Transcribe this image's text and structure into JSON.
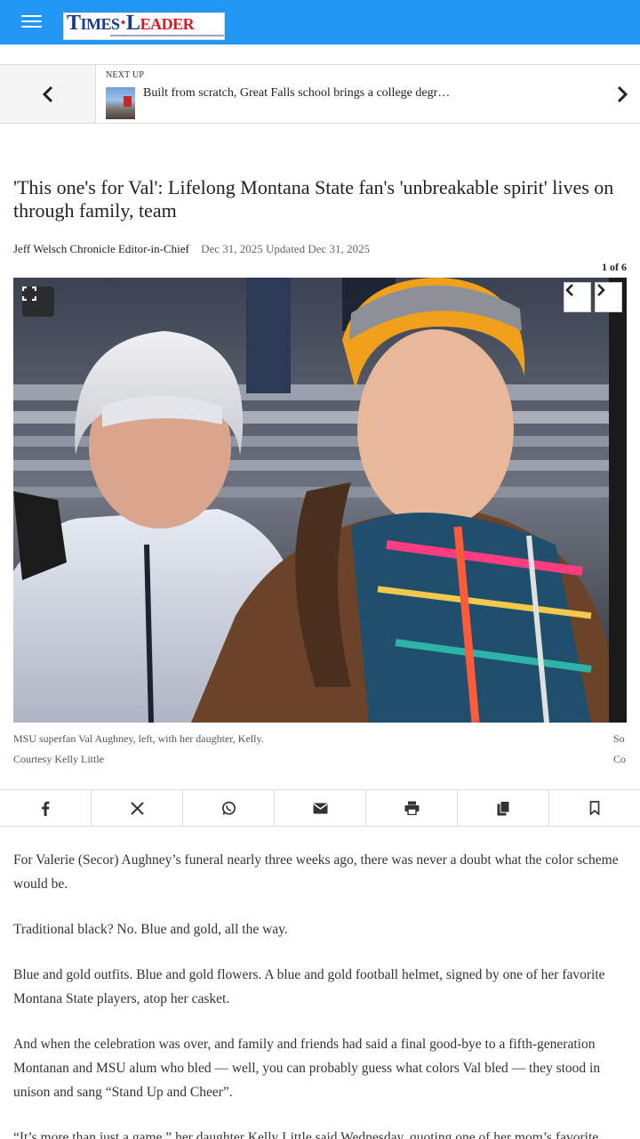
{
  "header": {
    "logo": {
      "part1": "Times",
      "part2": "Leader",
      "prefix": "T",
      "mid": "IMES",
      "dot": "·",
      "lead_L": "L",
      "lead_rest": "EADER"
    },
    "brand_colors": {
      "bar": "#2196f3",
      "logo_blue": "#163a92",
      "logo_red": "#d71920"
    }
  },
  "next_up": {
    "label": "NEXT UP",
    "title": "Built from scratch, Great Falls school brings a college degr…"
  },
  "article": {
    "headline": "'This one's for Val': Lifelong Montana State fan's 'unbreakable spirit' lives on through family, team",
    "author": "Jeff Welsch Chronicle Editor-in-Chief",
    "dates": "Dec 31, 2025 Updated Dec 31, 2025",
    "gallery": {
      "counter": "1 of 6",
      "caption": "MSU superfan Val Aughney, left, with her daughter, Kelly.",
      "credit": "Courtesy Kelly Little",
      "next_caption_peek": "So",
      "next_credit_peek": "Co"
    },
    "paragraphs": [
      "For Valerie (Secor) Aughney’s funeral nearly three weeks ago, there was never a doubt what the color scheme would be.",
      "Traditional black? No. Blue and gold, all the way.",
      "Blue and gold outfits. Blue and gold flowers. A blue and gold football helmet, signed by one of her favorite Montana State players, atop her casket.",
      "And when the celebration was over, and family and friends had said a final good-bye to a fifth-generation Montanan and MSU alum who bled — well, you can probably guess what colors Val bled — they stood in unison and sang “Stand Up and Cheer”.",
      "“It’s more than just a game,” her daughter Kelly Little said Wednesday, quoting one of her mom’s favorite"
    ]
  },
  "share": {
    "icons": [
      "facebook-icon",
      "x-icon",
      "whatsapp-icon",
      "email-icon",
      "print-icon",
      "copy-icon",
      "bookmark-icon"
    ]
  }
}
